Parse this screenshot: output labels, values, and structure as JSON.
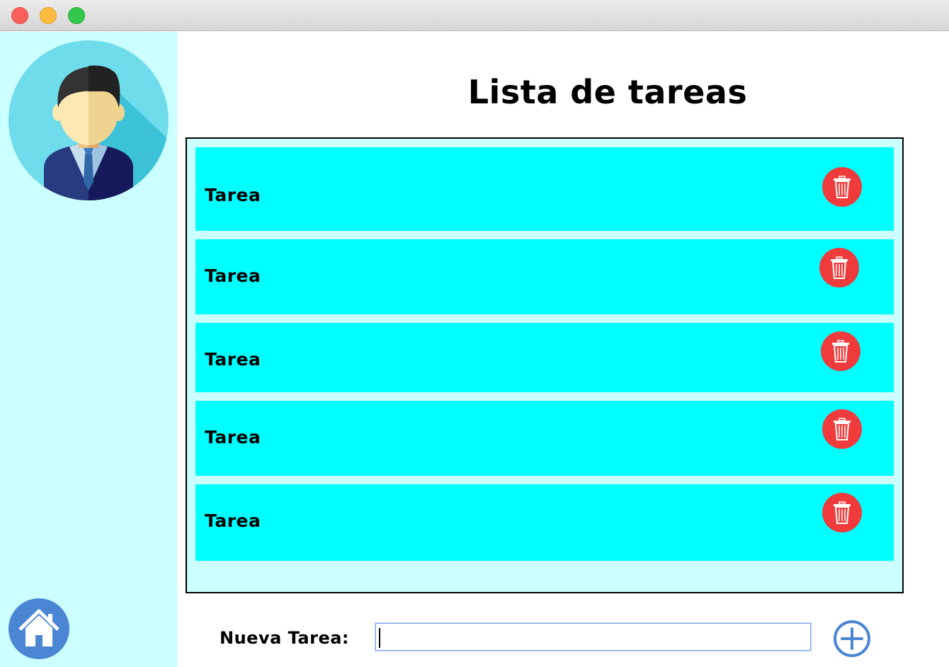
{
  "window": {
    "controls": [
      "close",
      "minimize",
      "maximize"
    ]
  },
  "sidebar": {
    "avatar_icon": "user-avatar-icon",
    "home_icon": "home-icon"
  },
  "main": {
    "title": "Lista de tareas",
    "tasks": [
      {
        "label": "Tarea",
        "action_icon": "trash-icon"
      },
      {
        "label": "Tarea",
        "action_icon": "trash-icon"
      },
      {
        "label": "Tarea",
        "action_icon": "trash-icon"
      },
      {
        "label": "Tarea",
        "action_icon": "trash-icon"
      },
      {
        "label": "Tarea",
        "action_icon": "trash-icon"
      }
    ],
    "new_task": {
      "label": "Nueva Tarea:",
      "value": "",
      "add_icon": "plus-circle-icon"
    }
  },
  "colors": {
    "sidebar_bg": "#ccffff",
    "panel_bg": "#ccffff",
    "task_row_bg": "#00ffff",
    "delete_button": "#ef3b3b",
    "accent_blue": "#4a86d4"
  }
}
